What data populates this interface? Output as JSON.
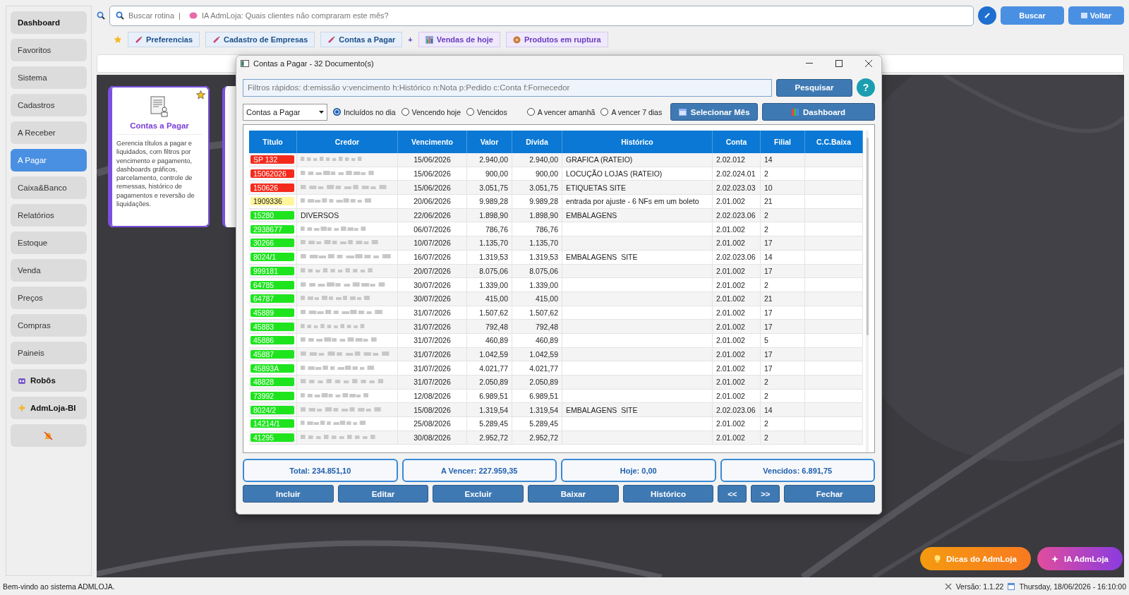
{
  "sidebar": {
    "items": [
      {
        "kind": "heading",
        "label": "Dashboard",
        "selected": false
      },
      {
        "kind": "plain",
        "label": "Favoritos",
        "selected": false
      },
      {
        "kind": "plain",
        "label": "Sistema",
        "selected": false
      },
      {
        "kind": "plain",
        "label": "Cadastros",
        "selected": false
      },
      {
        "kind": "plain",
        "label": "A Receber",
        "selected": false
      },
      {
        "kind": "plain",
        "label": "A Pagar",
        "selected": true
      },
      {
        "kind": "plain",
        "label": "Caixa&Banco",
        "selected": false
      },
      {
        "kind": "plain",
        "label": "Relatórios",
        "selected": false
      },
      {
        "kind": "plain",
        "label": "Estoque",
        "selected": false
      },
      {
        "kind": "plain",
        "label": "Venda",
        "selected": false
      },
      {
        "kind": "plain",
        "label": "Preços",
        "selected": false
      },
      {
        "kind": "plain",
        "label": "Compras",
        "selected": false
      },
      {
        "kind": "plain",
        "label": "Paineis",
        "selected": false
      },
      {
        "kind": "robot",
        "label": "Robôs",
        "selected": false
      },
      {
        "kind": "sparkle",
        "label": "AdmLoja-BI",
        "selected": false
      },
      {
        "kind": "mute",
        "selected": false
      }
    ]
  },
  "search": {
    "placeholder": "Buscar rotina  |  ",
    "ai_placeholder": "IA AdmLoja: Quais clientes não compraram este mês?",
    "buttons": [
      "Buscar",
      "Voltar"
    ]
  },
  "shortcuts": [
    {
      "kind": "tab",
      "label": "Preferencias"
    },
    {
      "kind": "tab",
      "label": "Cadastro de Empresas"
    },
    {
      "kind": "tab",
      "label": "Contas a Pagar"
    },
    {
      "kind": "separator",
      "label": "+"
    },
    {
      "kind": "sales",
      "label": "Vendas de hoje"
    },
    {
      "kind": "stock",
      "label": "Produtos em ruptura"
    }
  ],
  "card": {
    "title": "Contas a Pagar",
    "description": "Gerencia títulos a pagar e liquidados, com filtros por vencimento e pagamento, dashboards gráficos, parcelamento, controle de remessas, histórico de pagamentos e reversão de liquidações.",
    "favorite": true
  },
  "dialog": {
    "title": "Contas a Pagar - 32 Documento(s)",
    "filter_placeholder": "Filtros rápidos: d:emissão v:vencimento h:Histórico n:Nota p:Pedido c:Conta f:Fornecedor",
    "search_button": "Pesquisar",
    "help": "?",
    "account_type": "Contas a Pagar",
    "radios": [
      {
        "label": "Incluídos no dia",
        "selected": true
      },
      {
        "label": "Vencendo hoje",
        "selected": false
      },
      {
        "label": "Vencidos",
        "selected": false
      },
      {
        "label": "A vencer amanhã",
        "selected": false
      },
      {
        "label": "A vencer 7 dias",
        "selected": false
      }
    ],
    "month_button": "Selecionar Mês",
    "dashboard_button": "Dashboard",
    "table": {
      "columns": [
        "Título",
        "Credor",
        "Vencimento",
        "Valor",
        "Dívida",
        "Histórico",
        "Conta",
        "Filial",
        "C.C.Baixa"
      ],
      "rows": [
        {
          "titulo": "SP 132",
          "color": "#f42a1c",
          "vencimento": "15/06/2026",
          "valor": "2.940,00",
          "divida": "2.940,00",
          "historico": "GRAFICA (RATEIO)",
          "conta": "2.02.012",
          "filial": "14"
        },
        {
          "titulo": "15062026",
          "color": "#f42a1c",
          "vencimento": "15/06/2026",
          "valor": "900,00",
          "divida": "900,00",
          "historico": "LOCUÇÃO LOJAS (RATEIO)",
          "conta": "2.02.024.01",
          "filial": "2"
        },
        {
          "titulo": "150626",
          "color": "#f42a1c",
          "vencimento": "15/06/2026",
          "valor": "3.051,75",
          "divida": "3.051,75",
          "historico": "ETIQUETAS SITE",
          "conta": "2.02.023.03",
          "filial": "10"
        },
        {
          "titulo": "1909336",
          "color": "#fff59a",
          "vencimento": "20/06/2026",
          "valor": "9.989,28",
          "divida": "9.989,28",
          "historico": "entrada por ajuste - 6 NFs em um boleto",
          "conta": "2.01.002",
          "filial": "21"
        },
        {
          "titulo": "15280",
          "color": "#1ee41e",
          "credor": "DIVERSOS",
          "vencimento": "22/06/2026",
          "valor": "1.898,90",
          "divida": "1.898,90",
          "historico": "EMBALAGENS",
          "conta": "2.02.023.06",
          "filial": "2"
        },
        {
          "titulo": "2938677",
          "color": "#1ee41e",
          "vencimento": "06/07/2026",
          "valor": "786,76",
          "divida": "786,76",
          "conta": "2.01.002",
          "filial": "2"
        },
        {
          "titulo": "30266",
          "color": "#1ee41e",
          "vencimento": "10/07/2026",
          "valor": "1.135,70",
          "divida": "1.135,70",
          "conta": "2.01.002",
          "filial": "17"
        },
        {
          "titulo": "8024/1",
          "color": "#1ee41e",
          "vencimento": "16/07/2026",
          "valor": "1.319,53",
          "divida": "1.319,53",
          "historico": "EMBALAGENS  SITE",
          "conta": "2.02.023.06",
          "filial": "14"
        },
        {
          "titulo": "999181",
          "color": "#1ee41e",
          "vencimento": "20/07/2026",
          "valor": "8.075,06",
          "divida": "8.075,06",
          "conta": "2.01.002",
          "filial": "17"
        },
        {
          "titulo": "64785",
          "color": "#1ee41e",
          "vencimento": "30/07/2026",
          "valor": "1.339,00",
          "divida": "1.339,00",
          "conta": "2.01.002",
          "filial": "2"
        },
        {
          "titulo": "64787",
          "color": "#1ee41e",
          "vencimento": "30/07/2026",
          "valor": "415,00",
          "divida": "415,00",
          "conta": "2.01.002",
          "filial": "21"
        },
        {
          "titulo": "45889",
          "color": "#1ee41e",
          "vencimento": "31/07/2026",
          "valor": "1.507,62",
          "divida": "1.507,62",
          "conta": "2.01.002",
          "filial": "17"
        },
        {
          "titulo": "45883",
          "color": "#1ee41e",
          "vencimento": "31/07/2026",
          "valor": "792,48",
          "divida": "792,48",
          "conta": "2.01.002",
          "filial": "17"
        },
        {
          "titulo": "45886",
          "color": "#1ee41e",
          "vencimento": "31/07/2026",
          "valor": "460,89",
          "divida": "460,89",
          "conta": "2.01.002",
          "filial": "5"
        },
        {
          "titulo": "45887",
          "color": "#1ee41e",
          "vencimento": "31/07/2026",
          "valor": "1.042,59",
          "divida": "1.042,59",
          "conta": "2.01.002",
          "filial": "17"
        },
        {
          "titulo": "45893A",
          "color": "#1ee41e",
          "vencimento": "31/07/2026",
          "valor": "4.021,77",
          "divida": "4.021,77",
          "conta": "2.01.002",
          "filial": "17"
        },
        {
          "titulo": "48828",
          "color": "#1ee41e",
          "vencimento": "31/07/2026",
          "valor": "2.050,89",
          "divida": "2.050,89",
          "conta": "2.01.002",
          "filial": "2"
        },
        {
          "titulo": "73992",
          "color": "#1ee41e",
          "vencimento": "12/08/2026",
          "valor": "6.989,51",
          "divida": "6.989,51",
          "conta": "2.01.002",
          "filial": "2"
        },
        {
          "titulo": "8024/2",
          "color": "#1ee41e",
          "vencimento": "15/08/2026",
          "valor": "1.319,54",
          "divida": "1.319,54",
          "historico": "EMBALAGENS  SITE",
          "conta": "2.02.023.06",
          "filial": "14"
        },
        {
          "titulo": "14214/1",
          "color": "#1ee41e",
          "vencimento": "25/08/2026",
          "valor": "5.289,45",
          "divida": "5.289,45",
          "conta": "2.01.002",
          "filial": "2"
        },
        {
          "titulo": "41295",
          "color": "#1ee41e",
          "vencimento": "30/08/2026",
          "valor": "2.952,72",
          "divida": "2.952,72",
          "conta": "2.01.002",
          "filial": "2"
        }
      ]
    },
    "totals": [
      "Total: 234.851,10",
      "A Vencer: 227.959,35",
      "Hoje: 0,00",
      "Vencidos: 6.891,75"
    ],
    "actions": [
      "Incluir",
      "Editar",
      "Excluir",
      "Baixar",
      "Histórico",
      "<<",
      ">>",
      "Fechar"
    ]
  },
  "floating_buttons": [
    {
      "label": "Dicas do AdmLoja",
      "kind": "tips"
    },
    {
      "label": "IA AdmLoja",
      "kind": "ai"
    }
  ],
  "status_bar": {
    "message": "Bem-vindo ao sistema ADMLOJA.",
    "version": "Versão: 1.1.22",
    "datetime": "Thursday, 18/06/2026 - 16:10:00"
  }
}
